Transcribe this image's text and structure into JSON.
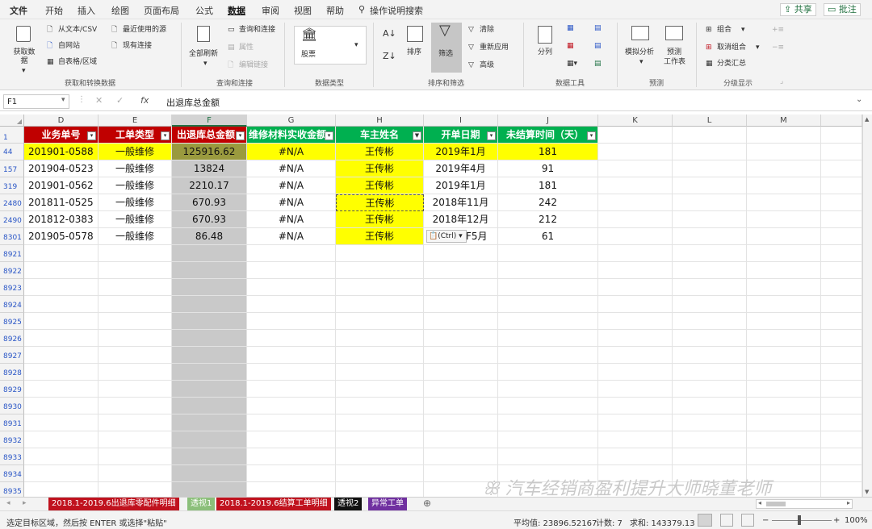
{
  "menu": {
    "tabs": [
      "文件",
      "开始",
      "插入",
      "绘图",
      "页面布局",
      "公式",
      "数据",
      "审阅",
      "视图",
      "帮助"
    ],
    "tell_me": "操作说明搜索",
    "share": "共享",
    "comments": "批注"
  },
  "ribbon": {
    "get_data": "获取数据",
    "from_text": "从文本/CSV",
    "from_web": "自网站",
    "from_table": "自表格/区域",
    "recent_sources": "最近使用的源",
    "existing_conn": "现有连接",
    "group_get": "获取和转换数据",
    "refresh_all": "全部刷新",
    "queries_conn": "查询和连接",
    "properties": "属性",
    "edit_links": "编辑链接",
    "group_queries": "查询和连接",
    "stocks": "股票",
    "group_datatype": "数据类型",
    "sort": "排序",
    "filter": "筛选",
    "clear": "清除",
    "reapply": "重新应用",
    "advanced": "高级",
    "group_sort": "排序和筛选",
    "split": "分列",
    "group_tools": "数据工具",
    "whatif": "模拟分析",
    "forecast_sheet": "预测",
    "forecast_sheet2": "工作表",
    "group_forecast": "预测",
    "group_btn": "组合",
    "ungroup_btn": "取消组合",
    "subtotal": "分类汇总",
    "group_outline": "分级显示"
  },
  "formula_bar": {
    "name_box": "F1",
    "fx": "fx",
    "content": "出退库总金额"
  },
  "grid": {
    "columns": [
      "D",
      "E",
      "F",
      "G",
      "H",
      "I",
      "J",
      "K",
      "L",
      "M"
    ],
    "header_row_number": "1",
    "headers": [
      "业务单号",
      "工单类型",
      "出退库总金额",
      "维修材料实收金额",
      "车主姓名",
      "开单日期",
      "未结算时间（天）"
    ],
    "rows": [
      {
        "num": "44",
        "cells": [
          "201901-0588",
          "一般维修",
          "125916.62",
          "#N/A",
          "王传彬",
          "2019年1月",
          "181"
        ]
      },
      {
        "num": "157",
        "cells": [
          "201904-0523",
          "一般维修",
          "13824",
          "#N/A",
          "王传彬",
          "2019年4月",
          "91"
        ]
      },
      {
        "num": "319",
        "cells": [
          "201901-0562",
          "一般维修",
          "2210.17",
          "#N/A",
          "王传彬",
          "2019年1月",
          "181"
        ]
      },
      {
        "num": "2480",
        "cells": [
          "201811-0525",
          "一般维修",
          "670.93",
          "#N/A",
          "王传彬",
          "2018年11月",
          "242"
        ]
      },
      {
        "num": "2490",
        "cells": [
          "201812-0383",
          "一般维修",
          "670.93",
          "#N/A",
          "王传彬",
          "2018年12月",
          "212"
        ]
      },
      {
        "num": "8301",
        "cells": [
          "201905-0578",
          "一般维修",
          "86.48",
          "#N/A",
          "王传彬",
          "2019年5月",
          "61"
        ]
      }
    ],
    "empty_rows": [
      "8921",
      "8922",
      "8923",
      "8924",
      "8925",
      "8926",
      "8927",
      "8928",
      "8929",
      "8930",
      "8931",
      "8932",
      "8933",
      "8934",
      "8935"
    ],
    "paste_options": "(Ctrl)",
    "last_date_visible": "F5月"
  },
  "sheet_tabs": [
    {
      "label": "2018.1-2019.6出退库零配件明细",
      "bg": "#c0121e",
      "color": "#ffffff"
    },
    {
      "label": "透视1",
      "bg": "#8bbf7a",
      "color": "#ffffff"
    },
    {
      "label": "2018.1-2019.6结算工单明细",
      "bg": "#c0121e",
      "color": "#ffffff"
    },
    {
      "label": "透视2",
      "bg": "#111111",
      "color": "#ffffff"
    },
    {
      "label": "异常工单",
      "bg": "#7030a0",
      "color": "#ffffff"
    }
  ],
  "watermark": "汽车经销商盈利提升大师晓董老师",
  "status": {
    "message": "选定目标区域，然后按 ENTER 或选择\"粘贴\"",
    "average": "平均值: 23896.52167",
    "count": "计数: 7",
    "sum": "求和: 143379.13",
    "zoom": "100%"
  },
  "colors": {
    "header_red": "#c00000",
    "header_green": "#00b050",
    "highlight_yellow": "#ffff00",
    "selected_gray": "#c9c9c9",
    "excel_green": "#217346"
  }
}
